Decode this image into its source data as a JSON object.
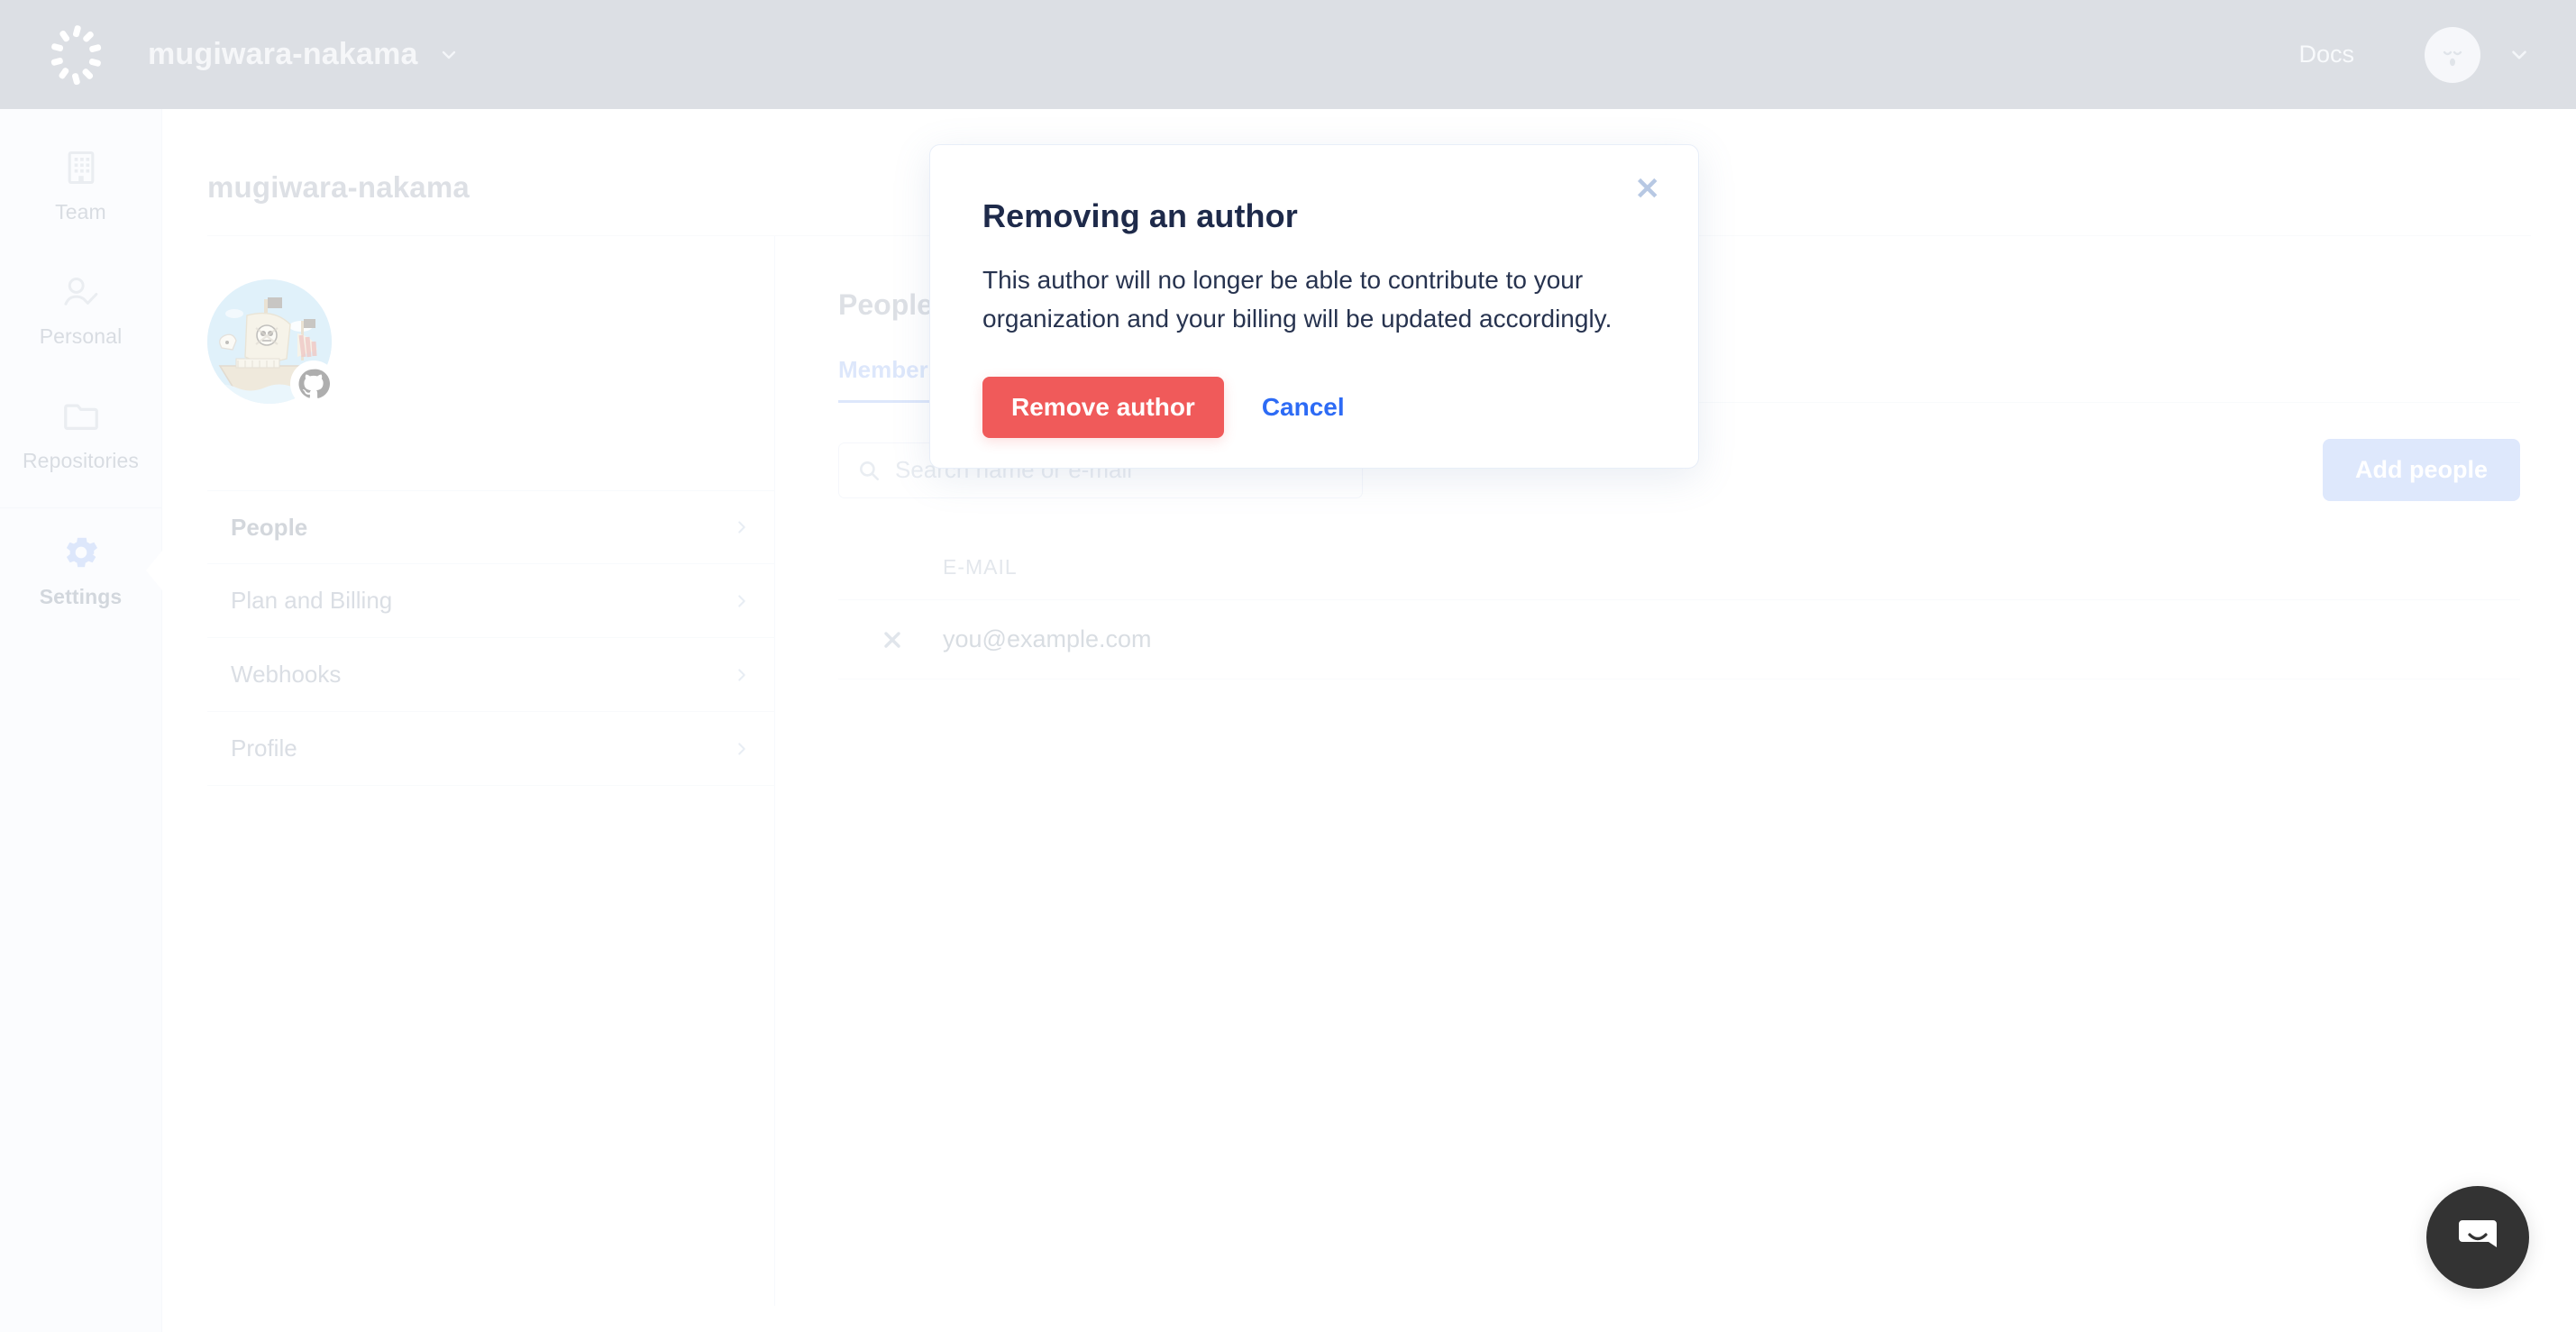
{
  "header": {
    "logo_icon": "dashed-circle-logo-icon",
    "org_name": "mugiwara-nakama",
    "org_caret_icon": "chevron-down-icon",
    "docs_label": "Docs",
    "avatar_icon": "user-avatar-face-icon",
    "user_caret_icon": "chevron-down-icon",
    "background_color": "#A3AAB7"
  },
  "rail": {
    "items": [
      {
        "label": "Team",
        "icon": "building-icon",
        "active": false
      },
      {
        "label": "Personal",
        "icon": "user-check-icon",
        "active": false
      },
      {
        "label": "Repositories",
        "icon": "folder-icon",
        "active": false
      },
      {
        "label": "Settings",
        "icon": "gear-icon",
        "active": true
      }
    ],
    "active_color": "#A7C0F5",
    "background_color": "#F4F8FC"
  },
  "page": {
    "title": "mugiwara-nakama"
  },
  "org_card": {
    "avatar_icon": "pirate-ship-avatar",
    "badge_icon": "github-icon"
  },
  "settings_menu": {
    "items": [
      {
        "label": "People",
        "active": true,
        "chevron_icon": "chevron-right-icon"
      },
      {
        "label": "Plan and Billing",
        "active": false,
        "chevron_icon": "chevron-right-icon"
      },
      {
        "label": "Webhooks",
        "active": false,
        "chevron_icon": "chevron-right-icon"
      },
      {
        "label": "Profile",
        "active": false,
        "chevron_icon": "chevron-right-icon"
      }
    ]
  },
  "people": {
    "section_title": "People",
    "tabs": [
      {
        "label": "Members",
        "active": true
      }
    ],
    "search": {
      "icon": "search-icon",
      "placeholder": "Search name or e-mail",
      "value": ""
    },
    "add_button_label": "Add people",
    "add_button_color": "#A9C3F8",
    "table": {
      "columns": [
        "E-MAIL"
      ],
      "rows": [
        {
          "remove_icon": "remove-x-icon",
          "email": "you@example.com"
        }
      ]
    }
  },
  "modal": {
    "title": "Removing an author",
    "body": "This author will no longer be able to contribute to your organization and your billing will be updated accordingly.",
    "confirm_label": "Remove author",
    "cancel_label": "Cancel",
    "close_icon": "close-icon",
    "confirm_color": "#F05A5A",
    "cancel_color": "#2D6BF5"
  },
  "intercom": {
    "icon": "intercom-chat-icon",
    "background_color": "#333333"
  }
}
